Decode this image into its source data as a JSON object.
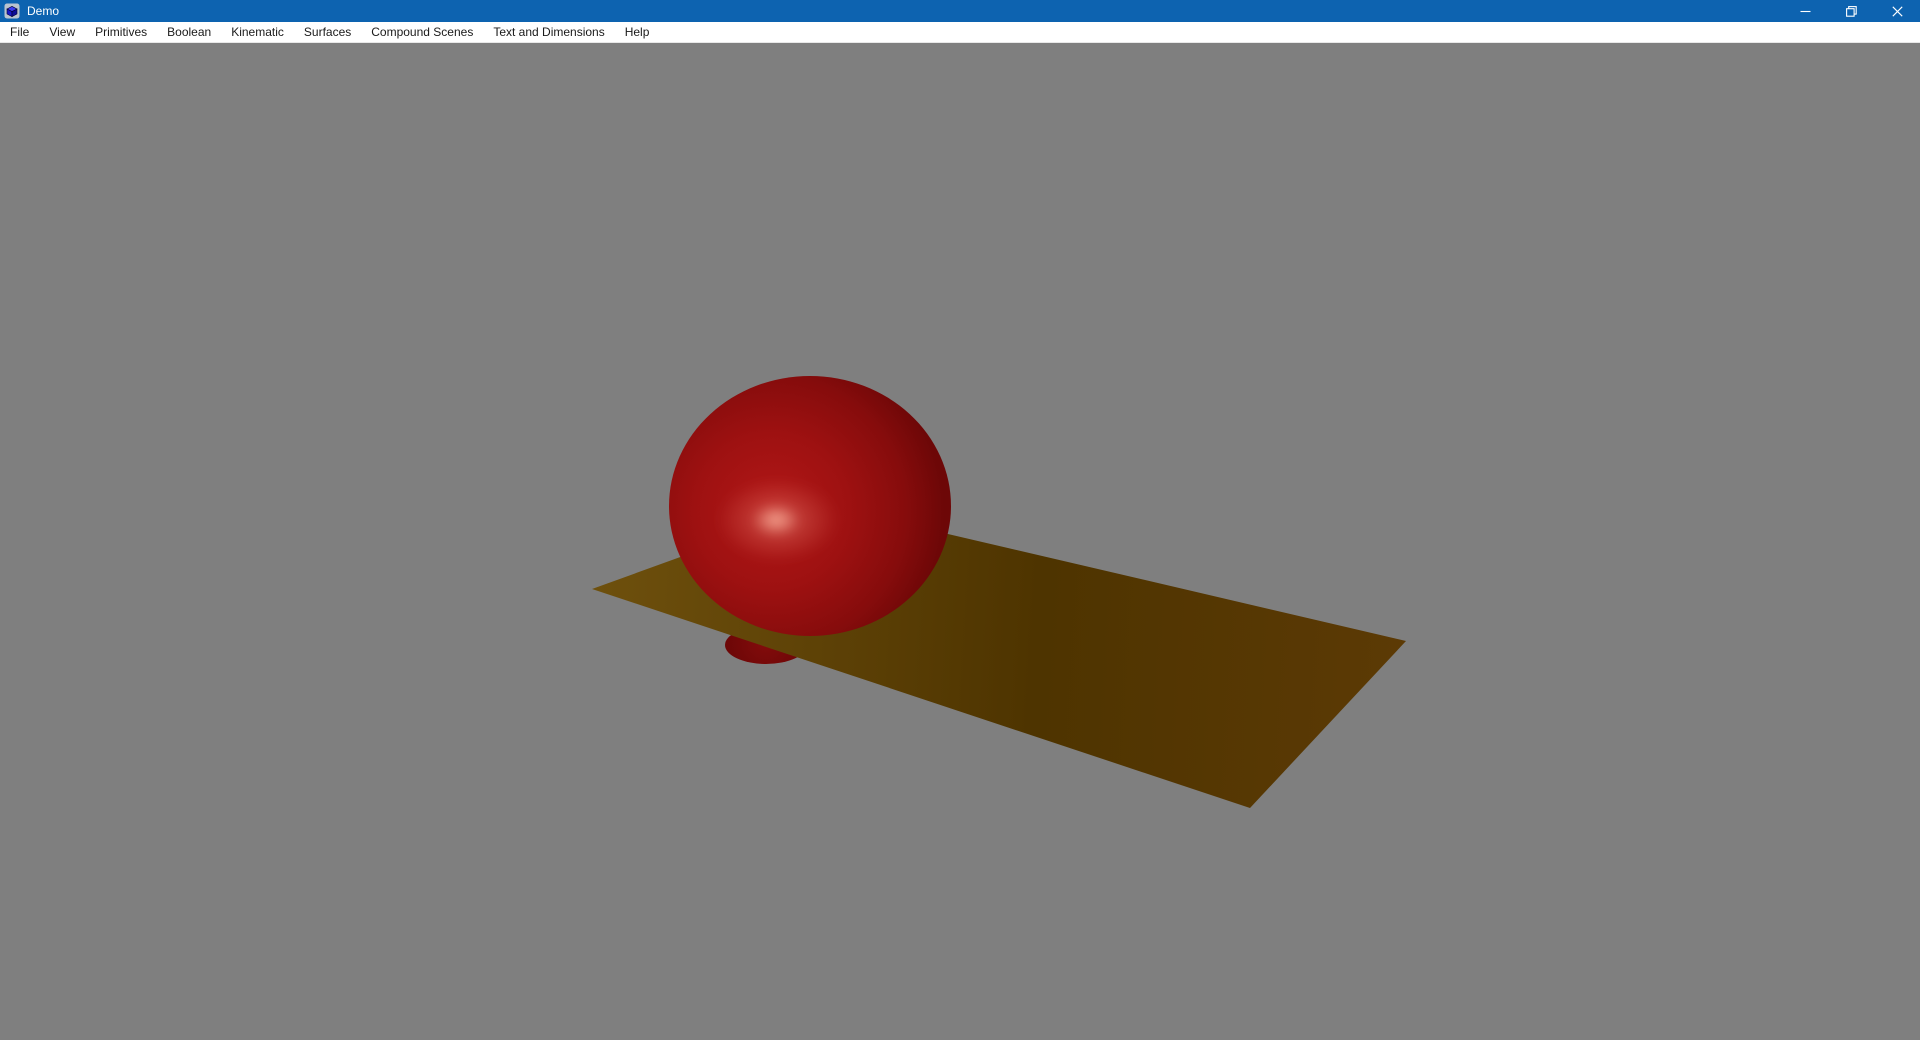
{
  "window": {
    "title": "Demo",
    "icon": "blue-cube-app-icon",
    "titlebar_color": "#0d63b0",
    "controls": [
      {
        "name": "minimize-icon"
      },
      {
        "name": "restore-icon"
      },
      {
        "name": "close-icon"
      }
    ]
  },
  "menu_bar": {
    "items": [
      {
        "label": "File"
      },
      {
        "label": "View"
      },
      {
        "label": "Primitives"
      },
      {
        "label": "Boolean"
      },
      {
        "label": "Kinematic"
      },
      {
        "label": "Surfaces"
      },
      {
        "label": "Compound Scenes"
      },
      {
        "label": "Text and Dimensions"
      },
      {
        "label": "Help"
      }
    ]
  },
  "viewport": {
    "background_color": "#7f7f7f",
    "scene_objects": [
      {
        "name": "red-sphere",
        "shape": "sphere",
        "base_color": "#a31212",
        "gradient": [
          "#b21717",
          "#9e1111",
          "#860c0c",
          "#6d0707"
        ],
        "highlight_color": "rgba(255,182,160,0.9)"
      },
      {
        "name": "olive-plane",
        "shape": "rectangular-plane",
        "gradient": [
          "#6e500d",
          "#4e3400",
          "#5c3a05"
        ]
      },
      {
        "name": "sphere-bottom-cap",
        "shape": "sphere-cap-below-plane",
        "color": "#840c0c",
        "edge_color": "#6a0606"
      }
    ]
  }
}
